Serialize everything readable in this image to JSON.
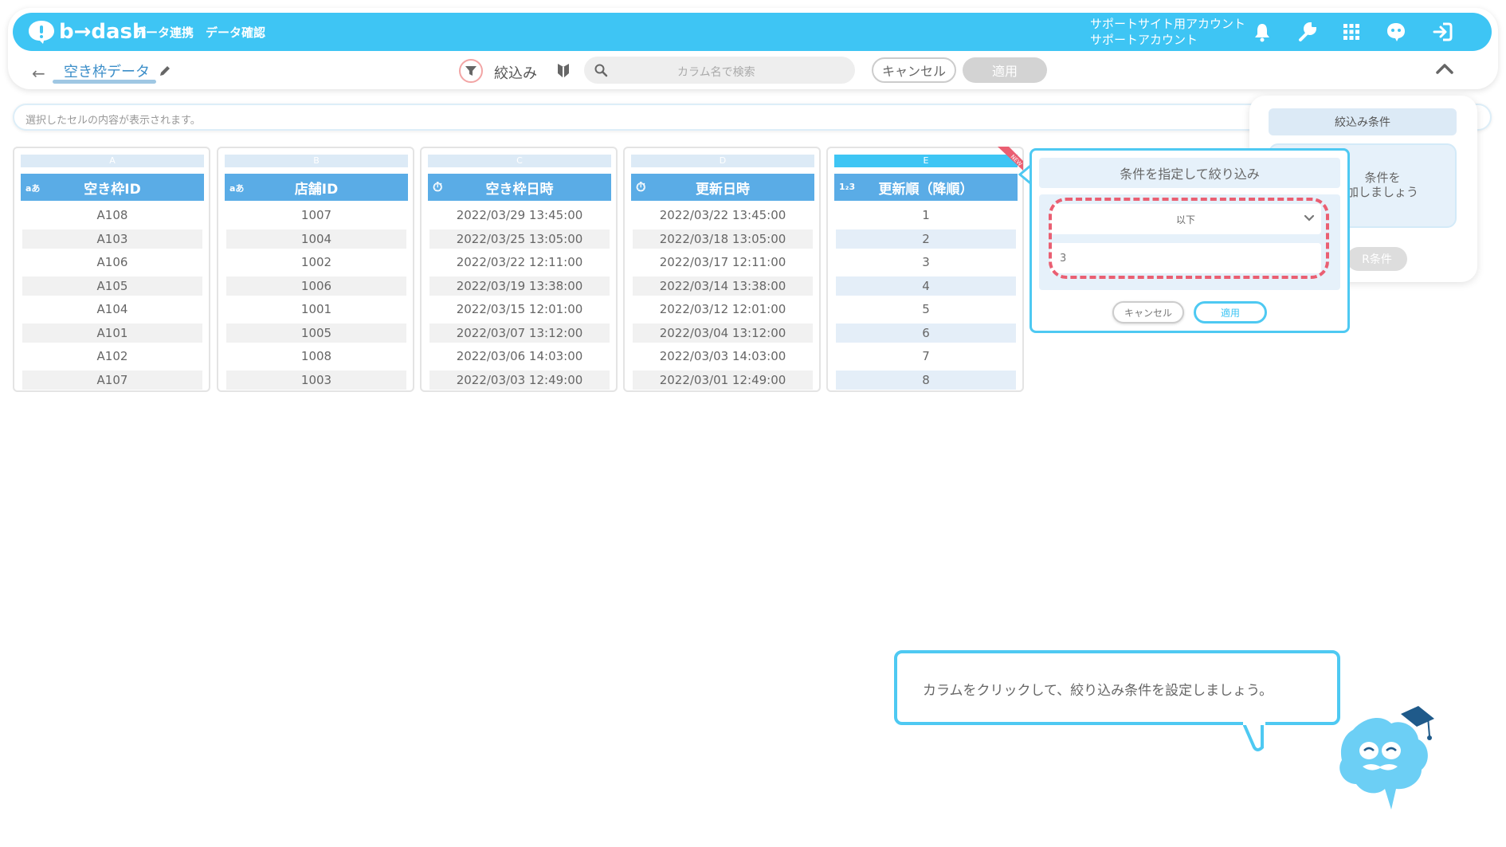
{
  "app": {
    "logo_text": "b→dash",
    "nav": [
      "データ連携",
      "データ確認"
    ],
    "account_line1": "サポートサイト用アカウント",
    "account_line2": "サポートアカウント"
  },
  "toolbar": {
    "back_icon": "←",
    "dataset_title": "空き枠データ",
    "filter_label": "絞込み",
    "search_placeholder": "カラム名で検索",
    "cancel_label": "キャンセル",
    "apply_label": "適用"
  },
  "cellbar": {
    "text": "選択したセルの内容が表示されます。"
  },
  "columns": [
    {
      "letter": "A",
      "type": "aあ",
      "title": "空き枠ID",
      "values": [
        "A108",
        "A103",
        "A106",
        "A105",
        "A104",
        "A101",
        "A102",
        "A107"
      ]
    },
    {
      "letter": "B",
      "type": "aあ",
      "title": "店舗ID",
      "values": [
        "1007",
        "1004",
        "1002",
        "1006",
        "1001",
        "1005",
        "1008",
        "1003"
      ]
    },
    {
      "letter": "C",
      "type": "⏱",
      "title": "空き枠日時",
      "values": [
        "2022/03/29 13:45:00",
        "2022/03/25 13:05:00",
        "2022/03/22 12:11:00",
        "2022/03/19 13:38:00",
        "2022/03/15 12:01:00",
        "2022/03/07 13:12:00",
        "2022/03/06 14:03:00",
        "2022/03/03 12:49:00"
      ]
    },
    {
      "letter": "D",
      "type": "⏱",
      "title": "更新日時",
      "values": [
        "2022/03/22 13:45:00",
        "2022/03/18 13:05:00",
        "2022/03/17 12:11:00",
        "2022/03/14 13:38:00",
        "2022/03/12 12:01:00",
        "2022/03/04 13:12:00",
        "2022/03/03 14:03:00",
        "2022/03/01 12:49:00"
      ]
    },
    {
      "letter": "E",
      "type": "1₂3",
      "title": "更新順（降順）",
      "values": [
        "1",
        "2",
        "3",
        "4",
        "5",
        "6",
        "7",
        "8"
      ]
    }
  ],
  "new_badge": "NEW",
  "condition_panel": {
    "title": "絞込み条件",
    "hint_line1": "条件を",
    "hint_line2": "加しましょう",
    "or_button": "R条件"
  },
  "popup": {
    "title": "条件を指定して絞り込み",
    "operator": "以下",
    "value": "3",
    "cancel_label": "キャンセル",
    "apply_label": "適用"
  },
  "tutorial": {
    "text": "カラムをクリックして、絞り込み条件を設定しましょう。"
  },
  "colors": {
    "brand": "#3ec5f4",
    "header": "#5aace6",
    "highlight": "#ea5f72"
  }
}
